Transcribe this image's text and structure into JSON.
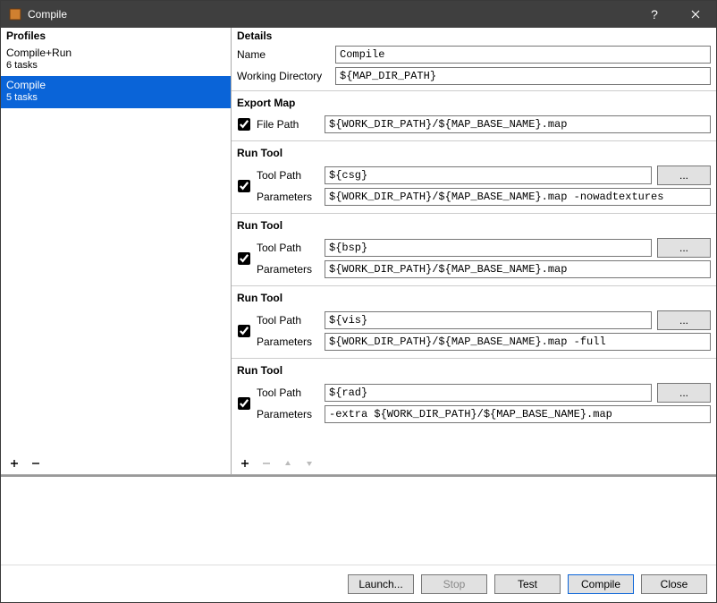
{
  "window": {
    "title": "Compile"
  },
  "profiles": {
    "header": "Profiles",
    "items": [
      {
        "name": "Compile+Run",
        "sub": "6 tasks",
        "selected": false
      },
      {
        "name": "Compile",
        "sub": "5 tasks",
        "selected": true
      }
    ]
  },
  "details": {
    "header": "Details",
    "name_label": "Name",
    "name_value": "Compile",
    "wd_label": "Working Directory",
    "wd_value": "${MAP_DIR_PATH}",
    "tasks": [
      {
        "title": "Export Map",
        "type": "export",
        "checked": true,
        "filepath_label": "File Path",
        "filepath_value": "${WORK_DIR_PATH}/${MAP_BASE_NAME}.map"
      },
      {
        "title": "Run Tool",
        "type": "run",
        "checked": true,
        "toolpath_label": "Tool Path",
        "toolpath_value": "${csg}",
        "params_label": "Parameters",
        "params_value": "${WORK_DIR_PATH}/${MAP_BASE_NAME}.map -nowadtextures"
      },
      {
        "title": "Run Tool",
        "type": "run",
        "checked": true,
        "toolpath_label": "Tool Path",
        "toolpath_value": "${bsp}",
        "params_label": "Parameters",
        "params_value": "${WORK_DIR_PATH}/${MAP_BASE_NAME}.map"
      },
      {
        "title": "Run Tool",
        "type": "run",
        "checked": true,
        "toolpath_label": "Tool Path",
        "toolpath_value": "${vis}",
        "params_label": "Parameters",
        "params_value": "${WORK_DIR_PATH}/${MAP_BASE_NAME}.map -full"
      },
      {
        "title": "Run Tool",
        "type": "run",
        "checked": true,
        "toolpath_label": "Tool Path",
        "toolpath_value": "${rad}",
        "params_label": "Parameters",
        "params_value": "-extra ${WORK_DIR_PATH}/${MAP_BASE_NAME}.map"
      }
    ]
  },
  "buttons": {
    "launch": "Launch...",
    "stop": "Stop",
    "test": "Test",
    "compile": "Compile",
    "close": "Close",
    "browse": "..."
  }
}
